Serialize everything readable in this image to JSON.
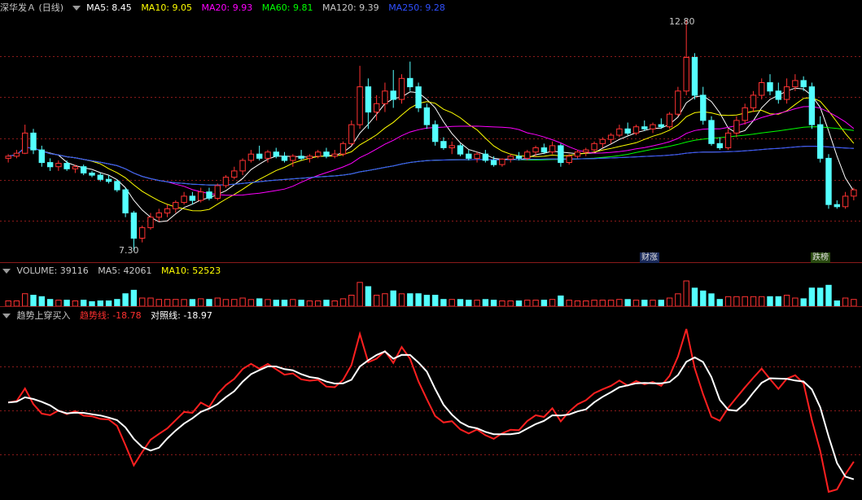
{
  "price_panel": {
    "title": "深华发Ａ (日线)",
    "indicators": [
      {
        "label": "MA5: 8.45",
        "color": "#ffffff"
      },
      {
        "label": "MA10: 9.05",
        "color": "#ffff00"
      },
      {
        "label": "MA20: 9.93",
        "color": "#ff00ff"
      },
      {
        "label": "MA60: 9.81",
        "color": "#00ff00"
      },
      {
        "label": "MA120: 9.39",
        "color": "#c8c8c8"
      },
      {
        "label": "MA250: 9.28",
        "color": "#3050ff"
      }
    ],
    "high_label": "12.80",
    "low_label": "7.30",
    "tag_up": "财涨",
    "tag_down": "跌榜"
  },
  "volume_panel": {
    "title": "VOLUME: 39116",
    "ma5": "MA5: 42061",
    "ma10": "MA10: 52523"
  },
  "indicator_panel": {
    "title": "趋势上穿买入",
    "trend": "趋势线: -18.78",
    "ref": "对照线: -18.97"
  },
  "colors": {
    "up": "#ff3232",
    "down": "#54ffff",
    "grid": "#8a1a1a",
    "trend": "#ff2020",
    "ref": "#ffffff"
  },
  "chart_data": {
    "type": "candlestick",
    "y_range": [
      7.3,
      12.8
    ],
    "candles": [
      [
        9.5,
        9.6,
        9.4,
        9.55
      ],
      [
        9.55,
        9.7,
        9.5,
        9.62
      ],
      [
        9.62,
        10.3,
        9.6,
        10.1
      ],
      [
        10.1,
        10.2,
        9.6,
        9.7
      ],
      [
        9.7,
        9.8,
        9.3,
        9.4
      ],
      [
        9.4,
        9.5,
        9.2,
        9.3
      ],
      [
        9.3,
        9.45,
        9.2,
        9.38
      ],
      [
        9.38,
        9.45,
        9.2,
        9.25
      ],
      [
        9.25,
        9.35,
        9.15,
        9.3
      ],
      [
        9.3,
        9.35,
        9.1,
        9.15
      ],
      [
        9.15,
        9.2,
        9.05,
        9.1
      ],
      [
        9.1,
        9.15,
        8.95,
        9.0
      ],
      [
        9.0,
        9.1,
        8.9,
        8.95
      ],
      [
        8.95,
        9.0,
        8.7,
        8.75
      ],
      [
        8.75,
        8.8,
        8.1,
        8.2
      ],
      [
        8.2,
        8.25,
        7.3,
        7.6
      ],
      [
        7.6,
        7.9,
        7.5,
        7.85
      ],
      [
        7.85,
        8.2,
        7.8,
        8.1
      ],
      [
        8.1,
        8.3,
        8.0,
        8.2
      ],
      [
        8.2,
        8.4,
        8.1,
        8.3
      ],
      [
        8.3,
        8.5,
        8.2,
        8.45
      ],
      [
        8.45,
        8.7,
        8.4,
        8.6
      ],
      [
        8.6,
        8.7,
        8.4,
        8.5
      ],
      [
        8.5,
        8.8,
        8.45,
        8.7
      ],
      [
        8.7,
        8.8,
        8.5,
        8.55
      ],
      [
        8.55,
        8.9,
        8.5,
        8.85
      ],
      [
        8.85,
        9.1,
        8.8,
        9.05
      ],
      [
        9.05,
        9.3,
        9.0,
        9.2
      ],
      [
        9.2,
        9.5,
        9.1,
        9.45
      ],
      [
        9.45,
        9.7,
        9.4,
        9.6
      ],
      [
        9.6,
        9.8,
        9.45,
        9.5
      ],
      [
        9.5,
        9.7,
        9.4,
        9.65
      ],
      [
        9.65,
        9.75,
        9.5,
        9.55
      ],
      [
        9.55,
        9.65,
        9.4,
        9.45
      ],
      [
        9.45,
        9.6,
        9.3,
        9.55
      ],
      [
        9.55,
        9.7,
        9.45,
        9.5
      ],
      [
        9.5,
        9.6,
        9.4,
        9.55
      ],
      [
        9.55,
        9.7,
        9.5,
        9.65
      ],
      [
        9.65,
        9.75,
        9.5,
        9.55
      ],
      [
        9.55,
        9.7,
        9.5,
        9.6
      ],
      [
        9.6,
        9.9,
        9.55,
        9.85
      ],
      [
        9.85,
        10.4,
        9.8,
        10.3
      ],
      [
        10.3,
        11.7,
        10.2,
        11.2
      ],
      [
        11.2,
        11.4,
        10.2,
        10.6
      ],
      [
        10.6,
        11.0,
        10.4,
        10.8
      ],
      [
        10.8,
        11.3,
        10.6,
        11.1
      ],
      [
        11.1,
        11.6,
        10.7,
        10.9
      ],
      [
        10.9,
        11.5,
        10.8,
        11.4
      ],
      [
        11.4,
        11.8,
        11.1,
        11.2
      ],
      [
        11.2,
        11.3,
        10.6,
        10.7
      ],
      [
        10.7,
        10.8,
        10.2,
        10.3
      ],
      [
        10.3,
        10.4,
        9.8,
        9.9
      ],
      [
        9.9,
        10.0,
        9.7,
        9.75
      ],
      [
        9.75,
        9.9,
        9.6,
        9.8
      ],
      [
        9.8,
        9.85,
        9.55,
        9.6
      ],
      [
        9.6,
        9.7,
        9.45,
        9.5
      ],
      [
        9.5,
        9.65,
        9.4,
        9.6
      ],
      [
        9.6,
        9.7,
        9.4,
        9.45
      ],
      [
        9.45,
        9.55,
        9.3,
        9.35
      ],
      [
        9.35,
        9.5,
        9.3,
        9.48
      ],
      [
        9.48,
        9.6,
        9.4,
        9.55
      ],
      [
        9.55,
        9.65,
        9.45,
        9.5
      ],
      [
        9.5,
        9.7,
        9.45,
        9.65
      ],
      [
        9.65,
        9.8,
        9.55,
        9.75
      ],
      [
        9.75,
        9.85,
        9.6,
        9.65
      ],
      [
        9.65,
        9.9,
        9.6,
        9.8
      ],
      [
        9.8,
        9.85,
        9.3,
        9.4
      ],
      [
        9.4,
        9.6,
        9.35,
        9.55
      ],
      [
        9.55,
        9.7,
        9.5,
        9.65
      ],
      [
        9.65,
        9.75,
        9.55,
        9.7
      ],
      [
        9.7,
        9.9,
        9.65,
        9.85
      ],
      [
        9.85,
        10.0,
        9.75,
        9.95
      ],
      [
        9.95,
        10.1,
        9.85,
        10.05
      ],
      [
        10.05,
        10.3,
        10.0,
        10.2
      ],
      [
        10.2,
        10.35,
        10.05,
        10.1
      ],
      [
        10.1,
        10.3,
        10.05,
        10.25
      ],
      [
        10.25,
        10.4,
        10.15,
        10.2
      ],
      [
        10.2,
        10.35,
        10.1,
        10.3
      ],
      [
        10.3,
        10.45,
        10.2,
        10.25
      ],
      [
        10.25,
        10.6,
        10.2,
        10.55
      ],
      [
        10.55,
        11.2,
        10.5,
        11.1
      ],
      [
        11.1,
        12.8,
        11.0,
        11.9
      ],
      [
        11.9,
        12.0,
        10.9,
        11.0
      ],
      [
        11.0,
        11.2,
        10.3,
        10.4
      ],
      [
        10.4,
        10.5,
        9.8,
        9.85
      ],
      [
        9.85,
        10.0,
        9.7,
        9.75
      ],
      [
        9.75,
        10.2,
        9.7,
        10.1
      ],
      [
        10.1,
        10.5,
        10.0,
        10.4
      ],
      [
        10.4,
        10.8,
        10.3,
        10.7
      ],
      [
        10.7,
        11.1,
        10.6,
        11.0
      ],
      [
        11.0,
        11.4,
        10.9,
        11.3
      ],
      [
        11.3,
        11.5,
        11.0,
        11.1
      ],
      [
        11.1,
        11.3,
        10.8,
        10.9
      ],
      [
        10.9,
        11.4,
        10.8,
        11.2
      ],
      [
        11.2,
        11.5,
        11.1,
        11.35
      ],
      [
        11.35,
        11.45,
        11.1,
        11.2
      ],
      [
        11.2,
        11.3,
        10.2,
        10.3
      ],
      [
        10.3,
        10.5,
        9.4,
        9.5
      ],
      [
        9.5,
        9.6,
        8.3,
        8.4
      ],
      [
        8.4,
        8.5,
        8.3,
        8.35
      ],
      [
        8.35,
        8.7,
        8.3,
        8.6
      ],
      [
        8.6,
        8.8,
        8.5,
        8.75
      ]
    ]
  }
}
